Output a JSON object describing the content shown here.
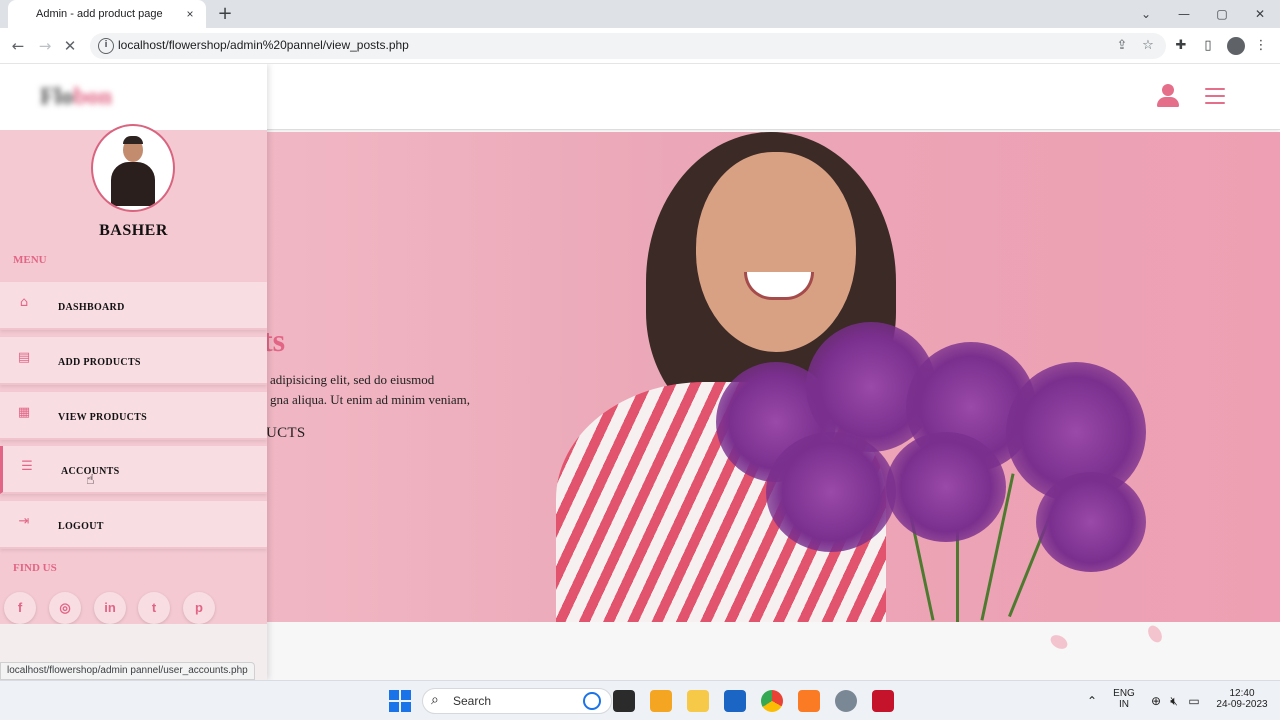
{
  "browser": {
    "tab_title": "Admin - add product page",
    "tab_close": "×",
    "new_tab": "+",
    "url": "localhost/flowershop/admin%20pannel/view_posts.php",
    "status_url": "localhost/flowershop/admin pannel/user_accounts.php"
  },
  "header": {
    "logo_main": "Flo",
    "logo_accent": "bon"
  },
  "sidebar": {
    "admin_name": "BASHER",
    "menu_heading": "MENU",
    "items": [
      {
        "label": "DASHBOARD",
        "icon": "home-icon"
      },
      {
        "label": "ADD PRODUCTS",
        "icon": "add-products-icon"
      },
      {
        "label": "VIEW PRODUCTS",
        "icon": "view-products-icon"
      },
      {
        "label": "ACCOUNTS",
        "icon": "accounts-icon"
      },
      {
        "label": "LOGOUT",
        "icon": "logout-icon"
      }
    ],
    "find_us_heading": "FIND US",
    "social": [
      {
        "glyph": "f",
        "icon": "facebook-icon"
      },
      {
        "glyph": "◎",
        "icon": "instagram-icon"
      },
      {
        "glyph": "in",
        "icon": "linkedin-icon"
      },
      {
        "glyph": "t",
        "icon": "twitter-icon"
      },
      {
        "glyph": "p",
        "icon": "pinterest-icon"
      }
    ]
  },
  "hero": {
    "title_visible": "ts",
    "line1": "adipisicing elit, sed do eiusmod",
    "line2": "gna aliqua. Ut enim ad minim veniam,",
    "button_partial": "UCTS"
  },
  "taskbar": {
    "search_placeholder": "Search",
    "lang_line1": "ENG",
    "lang_line2": "IN",
    "time": "12:40",
    "date": "24-09-2023"
  },
  "colors": {
    "accent": "#e26585",
    "sidebar_bg": "#f5c9d2",
    "hero_bg": "#eba7b7"
  }
}
